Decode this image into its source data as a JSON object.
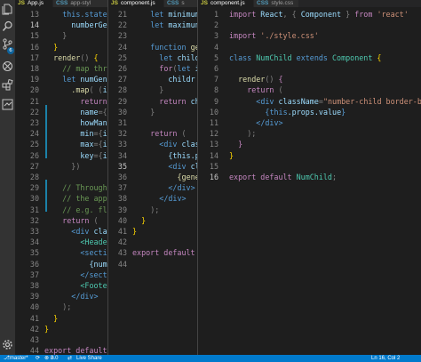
{
  "colors": {
    "activity_bg": "#333333",
    "editor_bg": "#1e1e1e",
    "status_bg": "#007acc"
  },
  "activity_icons": [
    "files-icon",
    "search-icon",
    "source-control-icon",
    "debug-icon",
    "extensions-icon",
    "remote-icon",
    "settings-gear-icon"
  ],
  "scm_badge": "6",
  "tabs": {
    "pane1": [
      {
        "label": "App.js",
        "type": "JS",
        "active": true
      },
      {
        "label": "app-styl",
        "type": "CSS",
        "active": false
      }
    ],
    "pane2": [
      {
        "label": "component.js",
        "type": "JS",
        "active": true
      },
      {
        "label": "s",
        "type": "CSS",
        "active": false
      }
    ],
    "pane3": [
      {
        "label": "component.js",
        "type": "JS",
        "active": true
      },
      {
        "label": "style.css",
        "type": "CSS",
        "active": false
      }
    ]
  },
  "pane1": {
    "cursor_line": "14",
    "lines": [
      {
        "n": "13",
        "i": 4,
        "t": [
          [
            "this.state ",
            "kw"
          ],
          [
            "= {",
            "pun"
          ]
        ]
      },
      {
        "n": "14",
        "i": 6,
        "t": [
          [
            "numberGen",
            "var"
          ]
        ]
      },
      {
        "n": "15",
        "i": 4,
        "t": [
          [
            "}",
            "pun"
          ]
        ]
      },
      {
        "n": "16",
        "i": 2,
        "t": [
          [
            "}",
            "brk"
          ]
        ]
      },
      {
        "n": "17",
        "i": 2,
        "t": [
          [
            "render",
            "fn"
          ],
          [
            "() ",
            "pun"
          ],
          [
            "{",
            "brk"
          ]
        ]
      },
      {
        "n": "18",
        "i": 4,
        "t": [
          [
            "// map thr",
            "cmt"
          ]
        ]
      },
      {
        "n": "19",
        "i": 4,
        "t": [
          [
            "let ",
            "kw"
          ],
          [
            "numGens",
            "var"
          ]
        ]
      },
      {
        "n": "20",
        "i": 6,
        "t": [
          [
            ".map",
            "fn"
          ],
          [
            "( (",
            "pun"
          ],
          [
            "item",
            "var"
          ]
        ]
      },
      {
        "n": "21",
        "i": 8,
        "t": [
          [
            "return ",
            "ctl"
          ],
          [
            "<N",
            "tag"
          ]
        ]
      },
      {
        "n": "22",
        "i": 8,
        "t": [
          [
            "name",
            "attr"
          ],
          [
            "={",
            "pun"
          ],
          [
            "item",
            "var"
          ]
        ]
      },
      {
        "n": "23",
        "i": 8,
        "t": [
          [
            "howMany",
            "attr"
          ],
          [
            "={",
            "pun"
          ]
        ]
      },
      {
        "n": "24",
        "i": 8,
        "t": [
          [
            "min",
            "attr"
          ],
          [
            "={",
            "pun"
          ],
          [
            "item",
            "var"
          ]
        ]
      },
      {
        "n": "25",
        "i": 8,
        "t": [
          [
            "max",
            "attr"
          ],
          [
            "={",
            "pun"
          ],
          [
            "item",
            "var"
          ]
        ]
      },
      {
        "n": "26",
        "i": 8,
        "t": [
          [
            "key",
            "attr"
          ],
          [
            "={",
            "pun"
          ],
          [
            "inde",
            "var"
          ]
        ]
      },
      {
        "n": "27",
        "i": 6,
        "t": [
          [
            "})",
            "pun"
          ]
        ]
      },
      {
        "n": "28",
        "i": 0,
        "t": [
          [
            "",
            "pun"
          ]
        ]
      },
      {
        "n": "29",
        "i": 4,
        "t": [
          [
            "// Throughou",
            "cmt"
          ]
        ]
      },
      {
        "n": "30",
        "i": 4,
        "t": [
          [
            "// the app-",
            "cmt"
          ]
        ]
      },
      {
        "n": "31",
        "i": 4,
        "t": [
          [
            "// e.g. fle",
            "cmt"
          ]
        ]
      },
      {
        "n": "32",
        "i": 4,
        "t": [
          [
            "return ",
            "ctl"
          ],
          [
            "(",
            "pun"
          ]
        ]
      },
      {
        "n": "33",
        "i": 6,
        "t": [
          [
            "<div ",
            "tag"
          ],
          [
            "clas",
            "attr"
          ]
        ]
      },
      {
        "n": "34",
        "i": 8,
        "t": [
          [
            "<Header",
            "cls"
          ]
        ]
      },
      {
        "n": "35",
        "i": 8,
        "t": [
          [
            "<sectio",
            "tag"
          ]
        ]
      },
      {
        "n": "36",
        "i": 10,
        "t": [
          [
            "{numG",
            "var"
          ]
        ]
      },
      {
        "n": "37",
        "i": 8,
        "t": [
          [
            "</sect",
            "tag"
          ]
        ]
      },
      {
        "n": "38",
        "i": 8,
        "t": [
          [
            "<Footer",
            "cls"
          ]
        ]
      },
      {
        "n": "39",
        "i": 6,
        "t": [
          [
            "</div>",
            "tag"
          ]
        ]
      },
      {
        "n": "40",
        "i": 4,
        "t": [
          [
            ");",
            "pun"
          ]
        ]
      },
      {
        "n": "41",
        "i": 2,
        "t": [
          [
            "}",
            "brk"
          ]
        ]
      },
      {
        "n": "42",
        "i": 0,
        "t": [
          [
            "}",
            "brk"
          ]
        ]
      },
      {
        "n": "43",
        "i": 0,
        "t": [
          [
            "",
            "pun"
          ]
        ]
      },
      {
        "n": "44",
        "i": 0,
        "t": [
          [
            "export ",
            "ctl"
          ],
          [
            "default ",
            "ctl"
          ],
          [
            "A",
            "cls"
          ]
        ]
      }
    ]
  },
  "pane2": {
    "cursor_line": "35",
    "lines": [
      {
        "n": "21",
        "i": 4,
        "t": [
          [
            "let ",
            "kw"
          ],
          [
            "minimum",
            "var"
          ]
        ]
      },
      {
        "n": "22",
        "i": 4,
        "t": [
          [
            "let ",
            "kw"
          ],
          [
            "maximun",
            "var"
          ]
        ]
      },
      {
        "n": "23",
        "i": 0,
        "t": [
          [
            "",
            "pun"
          ]
        ]
      },
      {
        "n": "24",
        "i": 4,
        "t": [
          [
            "function ",
            "kw"
          ],
          [
            "ge",
            "fn"
          ]
        ]
      },
      {
        "n": "25",
        "i": 6,
        "t": [
          [
            "let ",
            "kw"
          ],
          [
            "childr",
            "var"
          ]
        ]
      },
      {
        "n": "26",
        "i": 6,
        "t": [
          [
            "for",
            "ctl"
          ],
          [
            "(",
            "pun"
          ],
          [
            "let ",
            "kw"
          ],
          [
            "i",
            "var"
          ]
        ]
      },
      {
        "n": "27",
        "i": 8,
        "t": [
          [
            "childr",
            "var"
          ]
        ]
      },
      {
        "n": "28",
        "i": 6,
        "t": [
          [
            "}",
            "pun"
          ]
        ]
      },
      {
        "n": "29",
        "i": 6,
        "t": [
          [
            "return ",
            "ctl"
          ],
          [
            "ch",
            "var"
          ]
        ]
      },
      {
        "n": "30",
        "i": 4,
        "t": [
          [
            "}",
            "pun"
          ]
        ]
      },
      {
        "n": "31",
        "i": 0,
        "t": [
          [
            "",
            "pun"
          ]
        ]
      },
      {
        "n": "32",
        "i": 4,
        "t": [
          [
            "return ",
            "ctl"
          ],
          [
            "(",
            "pun"
          ]
        ]
      },
      {
        "n": "33",
        "i": 6,
        "t": [
          [
            "<div ",
            "tag"
          ],
          [
            "clas",
            "attr"
          ]
        ]
      },
      {
        "n": "34",
        "i": 8,
        "t": [
          [
            "{this.p",
            "var"
          ]
        ]
      },
      {
        "n": "35",
        "i": 8,
        "t": [
          [
            "<div ",
            "tag"
          ],
          [
            "cl",
            "attr"
          ]
        ]
      },
      {
        "n": "36",
        "i": 10,
        "t": [
          [
            "{gene",
            "fn"
          ]
        ]
      },
      {
        "n": "37",
        "i": 8,
        "t": [
          [
            "</div>",
            "tag"
          ]
        ]
      },
      {
        "n": "38",
        "i": 6,
        "t": [
          [
            "</div>",
            "tag"
          ]
        ]
      },
      {
        "n": "39",
        "i": 4,
        "t": [
          [
            ");",
            "pun"
          ]
        ]
      },
      {
        "n": "40",
        "i": 2,
        "t": [
          [
            "}",
            "brk"
          ]
        ]
      },
      {
        "n": "41",
        "i": 0,
        "t": [
          [
            "}",
            "brk"
          ]
        ]
      },
      {
        "n": "42",
        "i": 0,
        "t": [
          [
            "",
            "pun"
          ]
        ]
      },
      {
        "n": "43",
        "i": 0,
        "t": [
          [
            "export ",
            "ctl"
          ],
          [
            "default ",
            "ctl"
          ],
          [
            "",
            "cls"
          ]
        ]
      },
      {
        "n": "44",
        "i": 0,
        "t": [
          [
            "",
            "pun"
          ]
        ]
      }
    ]
  },
  "pane3": {
    "cursor_line": "16",
    "lines": [
      {
        "n": "1",
        "i": 0,
        "t": [
          [
            "import ",
            "ctl"
          ],
          [
            "React",
            "var"
          ],
          [
            ", { ",
            "pun"
          ],
          [
            "Component",
            "var"
          ],
          [
            " } ",
            "pun"
          ],
          [
            "from ",
            "ctl"
          ],
          [
            "'react'",
            "str"
          ]
        ]
      },
      {
        "n": "2",
        "i": 0,
        "t": [
          [
            "",
            "pun"
          ]
        ]
      },
      {
        "n": "3",
        "i": 0,
        "t": [
          [
            "import ",
            "ctl"
          ],
          [
            "'./style.css'",
            "str"
          ]
        ]
      },
      {
        "n": "4",
        "i": 0,
        "t": [
          [
            "",
            "pun"
          ]
        ]
      },
      {
        "n": "5",
        "i": 0,
        "t": [
          [
            "class ",
            "kw"
          ],
          [
            "NumChild ",
            "cls"
          ],
          [
            "extends ",
            "kw"
          ],
          [
            "Component ",
            "cls"
          ],
          [
            "{",
            "brk"
          ]
        ]
      },
      {
        "n": "6",
        "i": 0,
        "t": [
          [
            "",
            "pun"
          ]
        ]
      },
      {
        "n": "7",
        "i": 2,
        "t": [
          [
            "render",
            "fn"
          ],
          [
            "() ",
            "pun"
          ],
          [
            "{",
            "ctl"
          ]
        ]
      },
      {
        "n": "8",
        "i": 4,
        "t": [
          [
            "return ",
            "ctl"
          ],
          [
            "(",
            "pun"
          ]
        ]
      },
      {
        "n": "9",
        "i": 6,
        "t": [
          [
            "<div ",
            "tag"
          ],
          [
            "className",
            "attr"
          ],
          [
            "=",
            "pun"
          ],
          [
            "\"number-child border-box-gl",
            "str"
          ]
        ]
      },
      {
        "n": "10",
        "i": 8,
        "t": [
          [
            "{",
            "kw"
          ],
          [
            "this",
            "kw"
          ],
          [
            ".props.value",
            "var"
          ],
          [
            "}",
            "kw"
          ]
        ]
      },
      {
        "n": "11",
        "i": 6,
        "t": [
          [
            "</div>",
            "tag"
          ]
        ]
      },
      {
        "n": "12",
        "i": 4,
        "t": [
          [
            ");",
            "pun"
          ]
        ]
      },
      {
        "n": "13",
        "i": 2,
        "t": [
          [
            "}",
            "ctl"
          ]
        ]
      },
      {
        "n": "14",
        "i": 0,
        "t": [
          [
            "}",
            "brk"
          ]
        ]
      },
      {
        "n": "15",
        "i": 0,
        "t": [
          [
            "",
            "pun"
          ]
        ]
      },
      {
        "n": "16",
        "i": 0,
        "t": [
          [
            "export ",
            "ctl"
          ],
          [
            "default ",
            "ctl"
          ],
          [
            "NumChild",
            "cls"
          ],
          [
            ";",
            "pun"
          ]
        ]
      }
    ]
  },
  "statusbar": {
    "branch": "master*",
    "sync": "⟳",
    "errors": "0",
    "warnings": "0",
    "live_share": "⇄",
    "live_server": "Live Share",
    "position": "Ln 16, Col 2"
  }
}
